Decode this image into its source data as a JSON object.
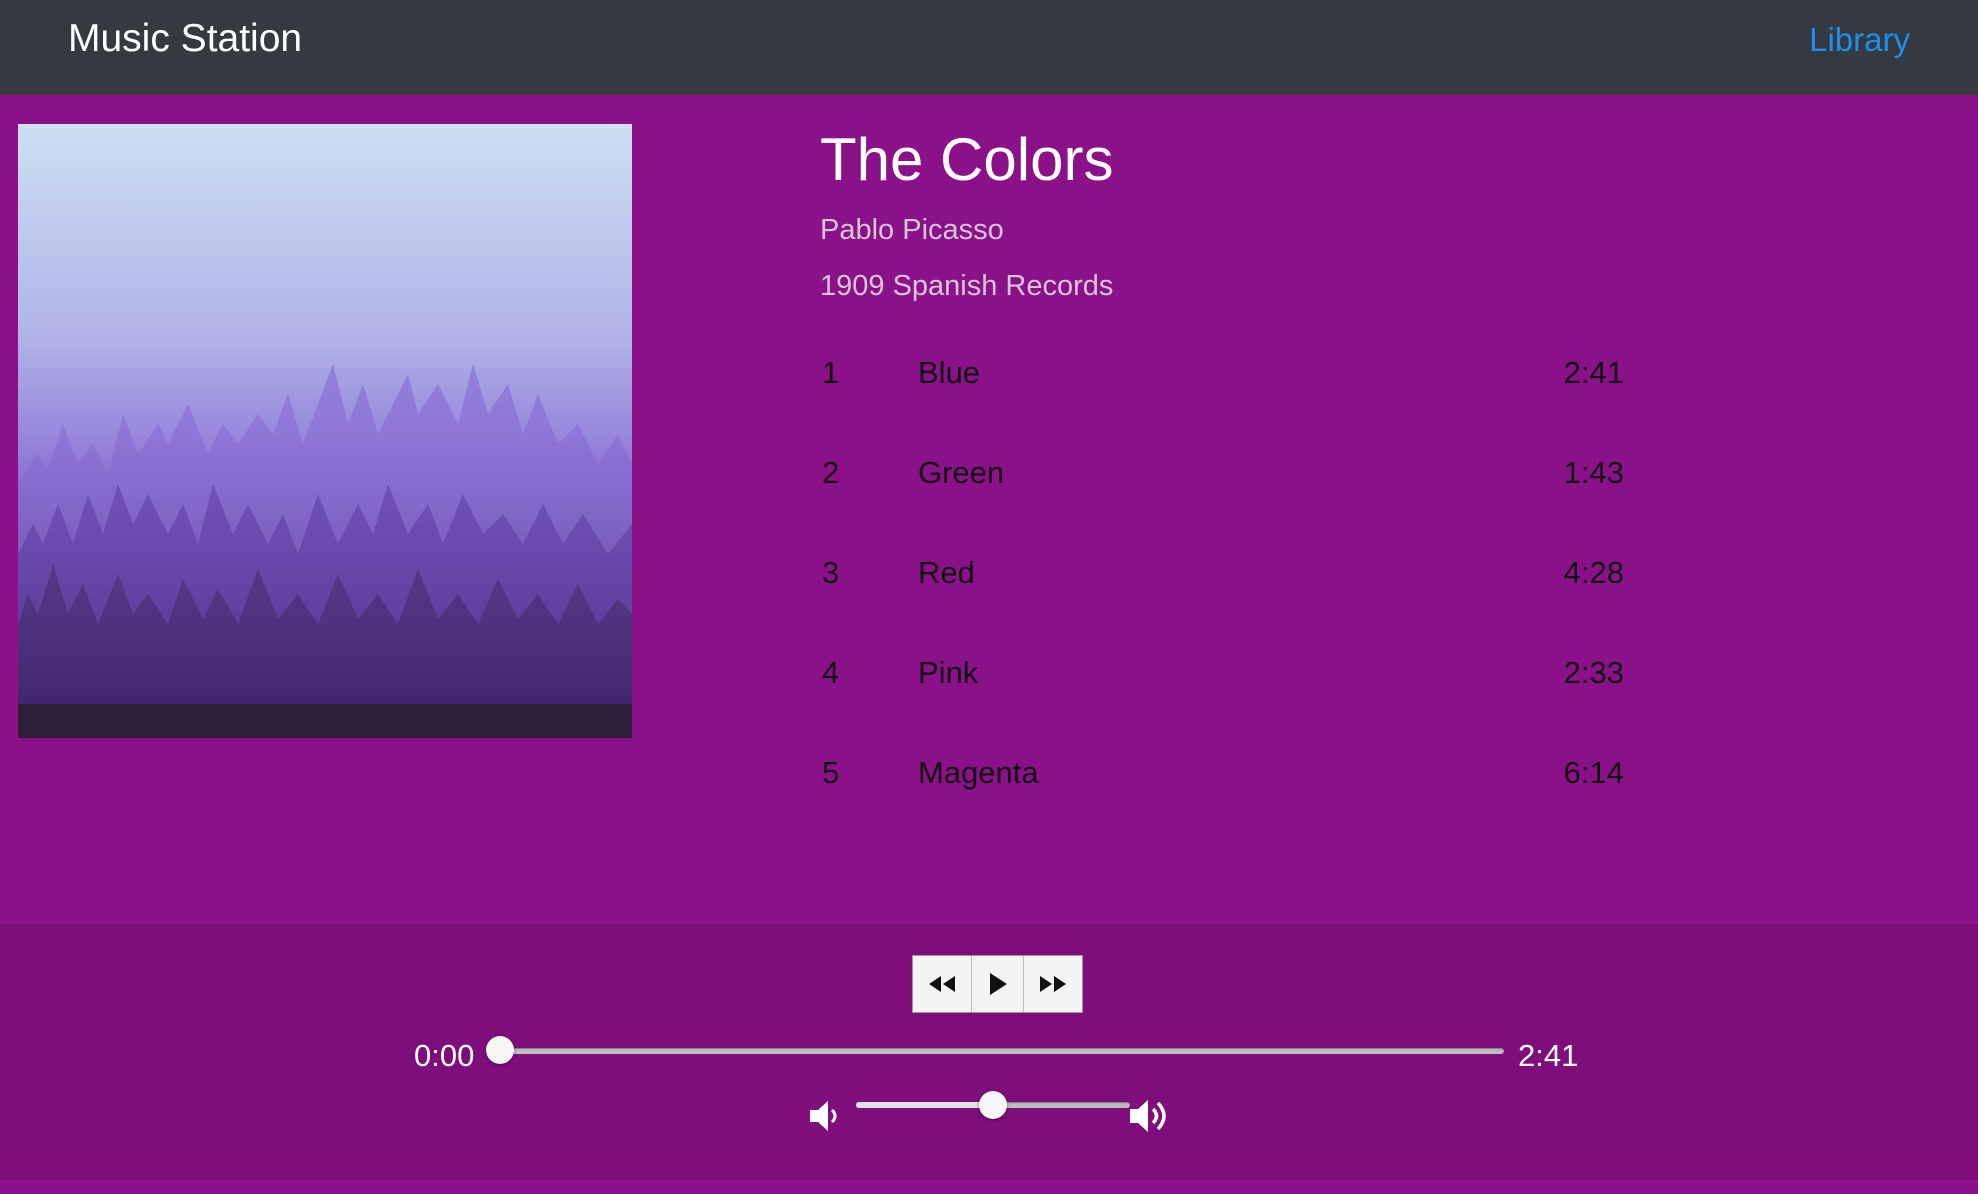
{
  "header": {
    "brand": "Music Station",
    "nav_link": "Library"
  },
  "album": {
    "title": "The Colors",
    "artist": "Pablo Picasso",
    "label": "1909 Spanish Records",
    "cover_icon": "album-cover-foggy-forest"
  },
  "tracks": [
    {
      "num": "1",
      "name": "Blue",
      "duration": "2:41"
    },
    {
      "num": "2",
      "name": "Green",
      "duration": "1:43"
    },
    {
      "num": "3",
      "name": "Red",
      "duration": "4:28"
    },
    {
      "num": "4",
      "name": "Pink",
      "duration": "2:33"
    },
    {
      "num": "5",
      "name": "Magenta",
      "duration": "6:14"
    }
  ],
  "player": {
    "buttons": [
      {
        "name": "rewind-button",
        "icon": "rewind-icon"
      },
      {
        "name": "play-button",
        "icon": "play-icon"
      },
      {
        "name": "fast-forward-button",
        "icon": "fast-forward-icon"
      }
    ],
    "current_time": "0:00",
    "total_time": "2:41",
    "progress": 0.0,
    "volume": 0.5
  },
  "colors": {
    "background": "#8b1189",
    "player_bar": "#7e0e7b",
    "header": "#343a40",
    "link": "#1e8ff0"
  }
}
